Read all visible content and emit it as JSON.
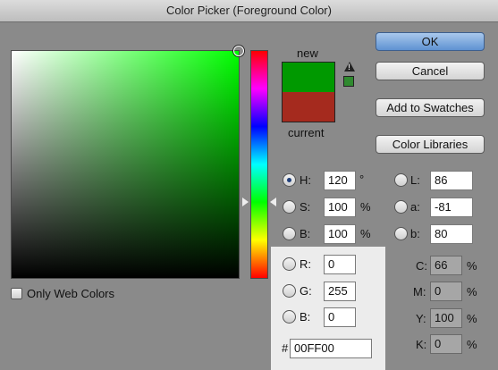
{
  "window": {
    "title": "Color Picker (Foreground Color)"
  },
  "preview": {
    "new_label": "new",
    "current_label": "current",
    "new_color": "#009900",
    "current_color": "#a52a1e"
  },
  "warnings": {
    "gamut_icon": "warning-triangle-icon",
    "websafe_color": "#2f8a2f"
  },
  "buttons": {
    "ok": "OK",
    "cancel": "Cancel",
    "add_to_swatches": "Add to Swatches",
    "color_libraries": "Color Libraries"
  },
  "web_only": {
    "label": "Only Web Colors",
    "checked": false
  },
  "hsb": {
    "h": {
      "label": "H:",
      "value": "120",
      "unit": "°"
    },
    "s": {
      "label": "S:",
      "value": "100",
      "unit": "%"
    },
    "b": {
      "label": "B:",
      "value": "100",
      "unit": "%"
    }
  },
  "rgb": {
    "r": {
      "label": "R:",
      "value": "0"
    },
    "g": {
      "label": "G:",
      "value": "255"
    },
    "b": {
      "label": "B:",
      "value": "0"
    }
  },
  "hex": {
    "label": "#",
    "value": "00FF00"
  },
  "lab": {
    "l": {
      "label": "L:",
      "value": "86"
    },
    "a": {
      "label": "a:",
      "value": "-81"
    },
    "b": {
      "label": "b:",
      "value": "80"
    }
  },
  "cmyk": {
    "c": {
      "label": "C:",
      "value": "66",
      "unit": "%"
    },
    "m": {
      "label": "M:",
      "value": "0",
      "unit": "%"
    },
    "y": {
      "label": "Y:",
      "value": "100",
      "unit": "%"
    },
    "k": {
      "label": "K:",
      "value": "0",
      "unit": "%"
    }
  },
  "colors": {
    "field_hue": "#00ff00",
    "selected_radio": "H"
  }
}
